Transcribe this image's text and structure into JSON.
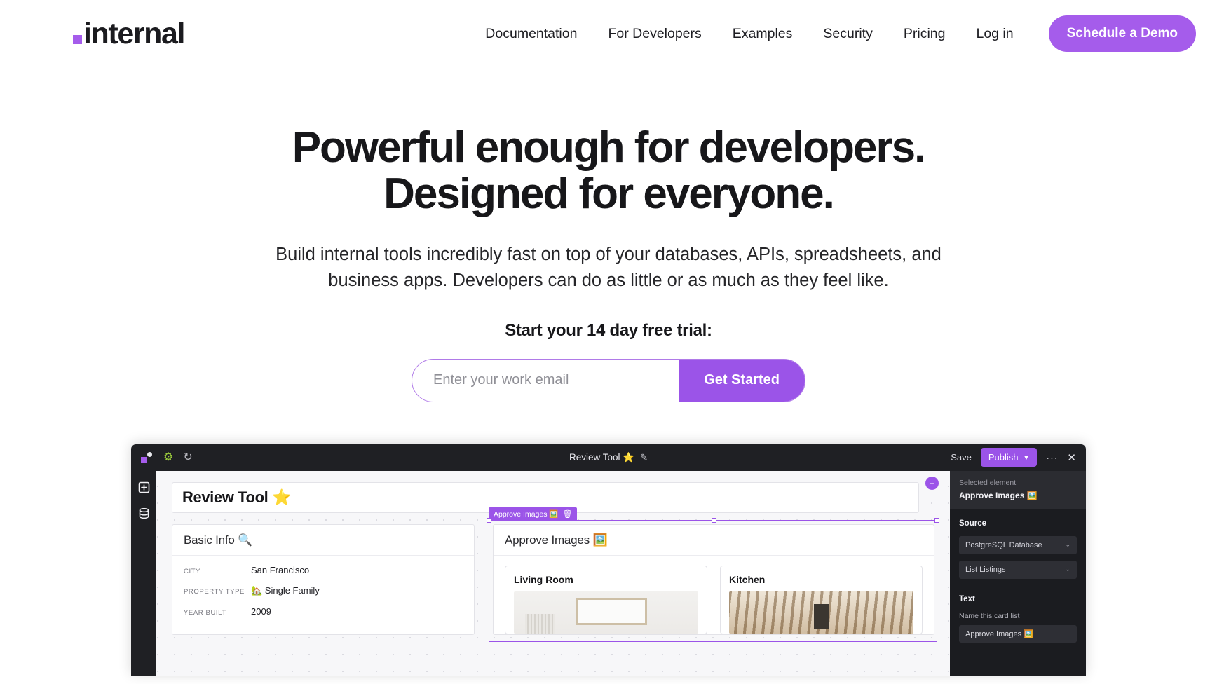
{
  "brand": {
    "logo_word": "internal",
    "accent": "#a55ceb",
    "accent_button": "#9b54e8"
  },
  "nav": {
    "links": [
      {
        "label": "Documentation"
      },
      {
        "label": "For Developers"
      },
      {
        "label": "Examples"
      },
      {
        "label": "Security"
      },
      {
        "label": "Pricing"
      },
      {
        "label": "Log in"
      }
    ],
    "cta_label": "Schedule a Demo"
  },
  "hero": {
    "headline_line1": "Powerful enough for developers.",
    "headline_line2": "Designed for everyone.",
    "subhead": "Build internal tools incredibly fast on top of your databases, APIs, spreadsheets, and business apps. Developers can do as little or as much as they feel like.",
    "trial_label": "Start your 14 day free trial:",
    "email_placeholder": "Enter your work email",
    "email_value": "",
    "submit_label": "Get Started"
  },
  "app": {
    "titlebar": {
      "logo_icon": "internal-mark-icon",
      "gear_icon": "gear-icon",
      "history_icon": "history-clock-icon",
      "title": "Review Tool ⭐",
      "edit_icon": "pencil-icon",
      "save_label": "Save",
      "publish_label": "Publish",
      "publish_caret": "▼",
      "more_label": "···",
      "close_label": "✕"
    },
    "rail": [
      {
        "name": "add-component-icon",
        "glyph": "⊞"
      },
      {
        "name": "data-sources-icon",
        "glyph": "🗄"
      }
    ],
    "canvas": {
      "page_title": "Review Tool ⭐",
      "add_button_label": "+",
      "basic_info": {
        "heading": "Basic Info 🔍",
        "rows": [
          {
            "key": "CITY",
            "value": "San Francisco"
          },
          {
            "key": "PROPERTY TYPE",
            "value": "🏡 Single Family"
          },
          {
            "key": "YEAR BUILT",
            "value": "2009"
          }
        ]
      },
      "approve_images": {
        "heading": "Approve Images 🖼️",
        "selection_badge": "Approve Images 🖼️",
        "delete_icon": "trash-icon",
        "cards": [
          {
            "title": "Living Room"
          },
          {
            "title": "Kitchen"
          }
        ]
      }
    },
    "inspector": {
      "selected_label": "Selected element",
      "selected_value": "Approve Images 🖼️",
      "source_heading": "Source",
      "source_database": "PostgreSQL Database",
      "source_query": "List Listings",
      "text_heading": "Text",
      "text_sublabel": "Name this card list",
      "text_value": "Approve Images 🖼️",
      "chevron": "⌄"
    }
  }
}
